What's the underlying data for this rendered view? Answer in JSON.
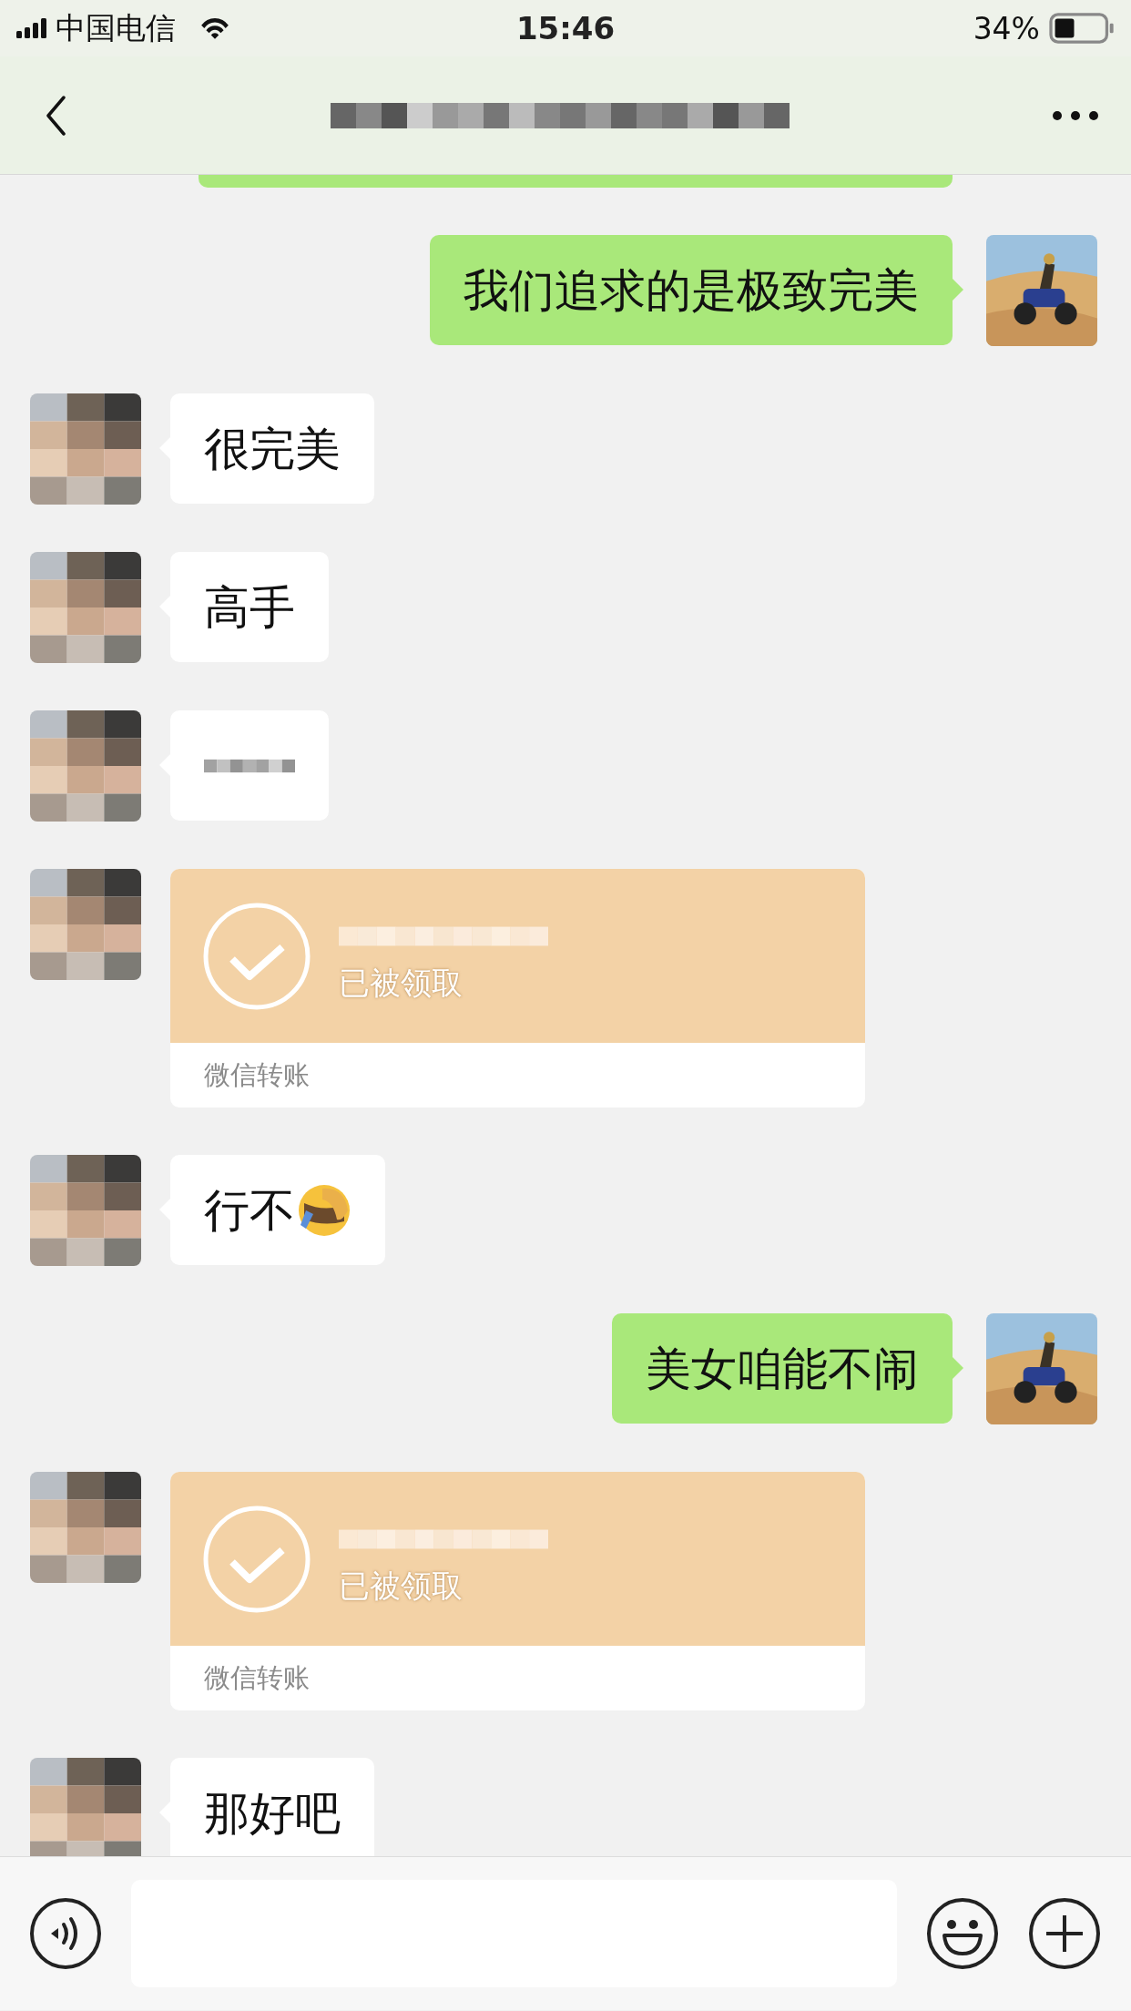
{
  "status_bar": {
    "carrier": "中国电信",
    "time": "15:46",
    "battery": "34%"
  },
  "nav": {
    "title": {
      "kind": "redacted"
    }
  },
  "messages": [
    {
      "outgoing": true,
      "kind": "partial"
    },
    {
      "outgoing": true,
      "kind": "text",
      "text": "我们追求的是极致完美"
    },
    {
      "outgoing": false,
      "kind": "text",
      "text": "很完美"
    },
    {
      "outgoing": false,
      "kind": "text",
      "text": "高手"
    },
    {
      "outgoing": false,
      "kind": "redacted"
    },
    {
      "outgoing": false,
      "kind": "transfer",
      "status": "已被领取",
      "label": "微信转账"
    },
    {
      "outgoing": false,
      "kind": "text",
      "text": "行不",
      "emoji": true
    },
    {
      "outgoing": true,
      "kind": "text",
      "text": "美女咱能不闹"
    },
    {
      "outgoing": false,
      "kind": "transfer",
      "status": "已被领取",
      "label": "微信转账"
    },
    {
      "outgoing": false,
      "kind": "text",
      "text": "那好吧"
    }
  ]
}
